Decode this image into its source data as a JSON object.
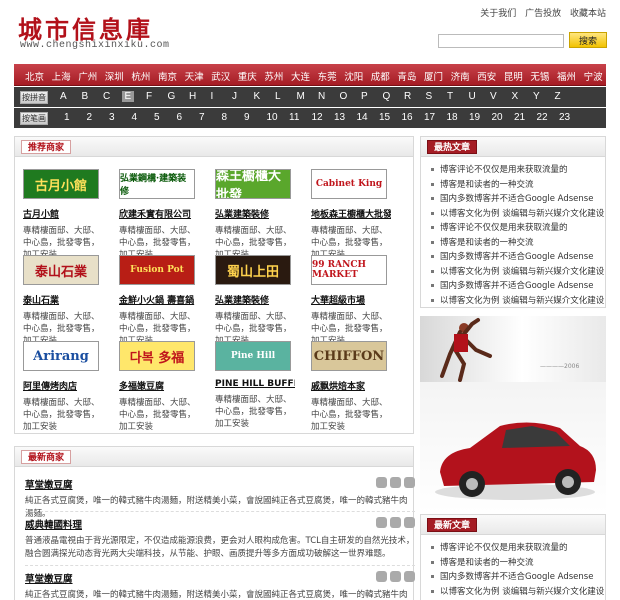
{
  "header": {
    "logo_text": "城市信息庫",
    "logo_url": "www.chengshixinxiku.com",
    "top_links": [
      "关于我们",
      "广告投放",
      "收藏本站"
    ],
    "search_placeholder": "",
    "search_button": "搜索"
  },
  "cities": [
    "北京",
    "上海",
    "广州",
    "深圳",
    "杭州",
    "南京",
    "天津",
    "武汉",
    "重庆",
    "苏州",
    "大连",
    "东莞",
    "沈阳",
    "成都",
    "青岛",
    "厦门",
    "济南",
    "西安",
    "昆明",
    "无锡",
    "福州",
    "宁波"
  ],
  "letter_row": {
    "tag": "按拼音",
    "items": [
      "A",
      "B",
      "C",
      "E",
      "F",
      "G",
      "H",
      "I",
      "J",
      "K",
      "L",
      "M",
      "N",
      "O",
      "P",
      "Q",
      "R",
      "S",
      "T",
      "U",
      "V",
      "X",
      "Y",
      "Z"
    ],
    "active": "E"
  },
  "number_row": {
    "tag": "按笔画",
    "items": [
      "1",
      "2",
      "3",
      "4",
      "5",
      "6",
      "7",
      "8",
      "9",
      "10",
      "11",
      "12",
      "13",
      "14",
      "15",
      "16",
      "17",
      "18",
      "19",
      "20",
      "21",
      "22",
      "23"
    ]
  },
  "recommended": {
    "title": "推荐商家",
    "desc": "專精樓面邸、大邸、中心島，批發零售，加工安装",
    "merchants": [
      {
        "name": "古月小館",
        "banner": "古月小館",
        "bg": "#1f7a1f",
        "fg": "#ffe15a"
      },
      {
        "name": "欣建禾實有限公司",
        "banner": "弘業鋼構·建築装修",
        "bg": "#ffffff",
        "fg": "#0a5a0a"
      },
      {
        "name": "弘業建築裝修",
        "banner": "森王櫥櫃大批發",
        "bg": "#5aa72c",
        "fg": "#ffffff"
      },
      {
        "name": "地板森王櫥櫃大批發",
        "banner": "Cabinet King",
        "bg": "#ffffff",
        "fg": "#c0151c"
      },
      {
        "name": "泰山石業",
        "banner": "泰山石業",
        "bg": "#e8e0c8",
        "fg": "#b2111a"
      },
      {
        "name": "金鮮小火鍋 壽喜鍋",
        "banner": "Fusion Pot",
        "bg": "#b81e15",
        "fg": "#ffe15a"
      },
      {
        "name": "弘業建築裝修",
        "banner": "蜀山上田",
        "bg": "#2a1a10",
        "fg": "#ffd34d"
      },
      {
        "name": "大華超級市場",
        "banner": "99 RANCH MARKET",
        "bg": "#ffffff",
        "fg": "#c0151c"
      },
      {
        "name": "阿里傳烤肉店",
        "banner": "Arirang",
        "bg": "#ffffff",
        "fg": "#1a4ea0"
      },
      {
        "name": "多福嫩豆腐",
        "banner": "다복 多福",
        "bg": "#ffe76b",
        "fg": "#c0151c"
      },
      {
        "name": "PINE HILL BUFFET",
        "banner": "Pine Hill",
        "bg": "#5ab3a0",
        "fg": "#ffffff"
      },
      {
        "name": "戚飘烘焙本家",
        "banner": "CHIFFON",
        "bg": "#d9c79a",
        "fg": "#5a3a1a"
      }
    ]
  },
  "latest": {
    "title": "最新商家",
    "items": [
      {
        "title": "草堂嫩豆腐",
        "desc": "純正各式豆腐煲，唯一的韓式豬牛肉湯麵，附送精美小菜，會說國純正各式豆腐煲，唯一的韓式豬牛肉湯麵。"
      },
      {
        "title": "威典韓國料理",
        "desc": "普通液晶電視由于背光源限定，不仅造成能源浪费，更会对人眼构成危害。TCL自主研发的自然光技术，融合圆满探光动态背光两大尖端科技，从节能、护眼、画质提升等多方面成功破解这一世界难题。"
      },
      {
        "title": "草堂嫩豆腐",
        "desc": "純正各式豆腐煲，唯一的韓式豬牛肉湯麵，附送精美小菜，會說國純正各式豆腐煲，唯一的韓式豬牛肉湯麵。"
      }
    ]
  },
  "hot": {
    "title": "最热文章",
    "items": [
      "博客评论不仅仅是用来获取流量的",
      "博客是和读者的一种交流",
      "国内多数博客并不适合Google Adsense",
      "以博客文化为例 谈编辑与新兴媒介文化建设",
      "博客评论不仅仅是用来获取流量的",
      "博客是和读者的一种交流",
      "国内多数博客并不适合Google Adsense",
      "以博客文化为例 谈编辑与新兴媒介文化建设",
      "国内多数博客并不适合Google Adsense",
      "以博客文化为例 谈编辑与新兴媒介文化建设"
    ]
  },
  "newest": {
    "title": "最新文章",
    "items": [
      "博客评论不仅仅是用来获取流量的",
      "博客是和读者的一种交流",
      "国内多数博客并不适合Google Adsense",
      "以博客文化为例 谈编辑与新兴媒介文化建设",
      "博客评论不仅仅是用来获取流量的"
    ]
  },
  "colors": {
    "brand_red": "#b2111a",
    "index_bg": "#3b3b3b"
  }
}
